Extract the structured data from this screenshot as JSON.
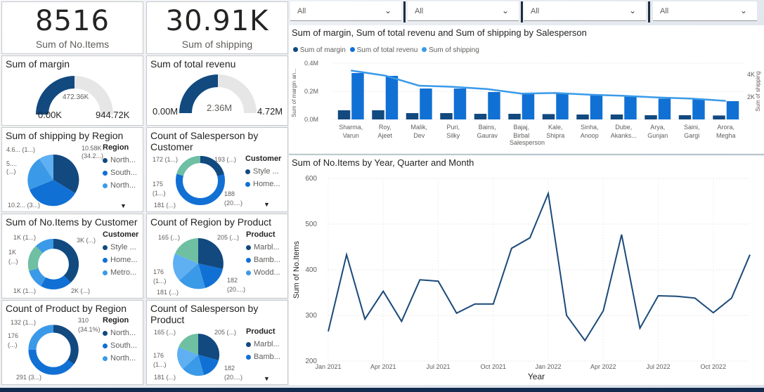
{
  "kpis": [
    {
      "value": "8516",
      "label": "Sum of No.Items"
    },
    {
      "value": "30.91K",
      "label": "Sum of shipping"
    }
  ],
  "gauges": [
    {
      "title": "Sum of margin",
      "min": "0.00K",
      "max": "944.72K",
      "center": "472.36K",
      "fill": 0.5
    },
    {
      "title": "Sum of total revenu",
      "min": "0.00M",
      "max": "4.72M",
      "center": "2.36M",
      "fill": 0.5
    }
  ],
  "slicers": [
    "All",
    "All",
    "All",
    "All"
  ],
  "pies": {
    "shipping_region": {
      "title": "Sum of shipping by Region",
      "legend_title": "Region",
      "legend": [
        "North...",
        "South...",
        "North..."
      ],
      "labels": [
        "10.58K",
        "(34.2...)",
        "4.6... (1...)",
        "5....",
        "(...)",
        "10.2... (3...)"
      ]
    },
    "salesperson_customer": {
      "title": "Count of Salesperson by Customer",
      "legend_title": "Customer",
      "legend": [
        "Style ...",
        "Home..."
      ],
      "labels": [
        "193 (...)",
        "172 (1...)",
        "175",
        "(1...)",
        "188",
        "(20....)",
        "181 (...)"
      ]
    },
    "items_customer": {
      "title": "Sum of No.Items by Customer",
      "legend_title": "Customer",
      "legend": [
        "Style ...",
        "Home...",
        "Metro..."
      ],
      "labels": [
        "1K (1...)",
        "3K (...)",
        "1K",
        "(...)",
        "1K (1...)",
        "2K (...)"
      ]
    },
    "region_product": {
      "title": "Count of Region by Product",
      "legend_title": "Product",
      "legend": [
        "Marbl...",
        "Bamb...",
        "Wodd..."
      ],
      "labels": [
        "165 (...)",
        "205 (...)",
        "176",
        "(1...)",
        "182",
        "(20....)",
        "181 (...)"
      ]
    },
    "product_region": {
      "title": "Count of Product by Region",
      "legend_title": "Region",
      "legend": [
        "North...",
        "South...",
        "North..."
      ],
      "labels": [
        "132 (1...)",
        "310",
        "(34.1%)",
        "176",
        "(...)",
        "291 (3...)"
      ]
    },
    "salesperson_product": {
      "title": "Count of Salesperson by Product",
      "legend_title": "Product",
      "legend": [
        "Marbl...",
        "Bamb..."
      ],
      "labels": [
        "165 (...)",
        "205 (...)",
        "176",
        "(1...)",
        "182",
        "(20....)",
        "181 (...)"
      ]
    }
  },
  "colors": {
    "dark_navy": "#12497f",
    "mid_blue": "#1170d4",
    "light_blue": "#3b9ae8",
    "teal": "#6fbfa3",
    "sky": "#5fb0f2",
    "line": "#1a4a7a"
  },
  "chart_data": [
    {
      "type": "bar",
      "title": "Sum of margin, Sum of total revenu and Sum of shipping by Salesperson",
      "legend": [
        "Sum of margin",
        "Sum of total revenu",
        "Sum of shipping"
      ],
      "xlabel": "Salesperson",
      "ylabel": "Sum of margin an...",
      "y2label": "Sum of shipping",
      "categories": [
        "Sharma, Varun",
        "Roy, Ajeet",
        "Malik, Dev",
        "Puri, Silky",
        "Bains, Gaurav",
        "Bajaj, Birbal",
        "Kale, Shipra",
        "Sinha, Anoop",
        "Dube, Akanks...",
        "Arya, Gunjan",
        "Saini, Gargi",
        "Arora, Megha"
      ],
      "y_ticks": [
        "0.0M",
        "0.2M",
        "0.4M"
      ],
      "y2_ticks": [
        "2K",
        "4K"
      ],
      "ylim": [
        0,
        0.4
      ],
      "y2lim": [
        0,
        5000
      ],
      "series": [
        {
          "name": "Sum of margin",
          "values": [
            0.065,
            0.065,
            0.045,
            0.045,
            0.04,
            0.04,
            0.038,
            0.035,
            0.035,
            0.03,
            0.03,
            0.028
          ]
        },
        {
          "name": "Sum of total revenu",
          "values": [
            0.33,
            0.31,
            0.22,
            0.22,
            0.195,
            0.19,
            0.185,
            0.17,
            0.165,
            0.148,
            0.145,
            0.13
          ]
        },
        {
          "name": "Sum of shipping",
          "values": [
            4350,
            3900,
            3000,
            2900,
            2700,
            2300,
            2350,
            2200,
            2100,
            1950,
            1850,
            1650
          ]
        }
      ]
    },
    {
      "type": "line",
      "title": "Sum of No.Items by Year, Quarter and Month",
      "xlabel": "Year",
      "ylabel": "Sum of No.Items",
      "x_ticks": [
        "Jan 2021",
        "Apr 2021",
        "Jul 2021",
        "Oct 2021",
        "Jan 2022",
        "Apr 2022",
        "Jul 2022",
        "Oct 2022"
      ],
      "y_ticks": [
        "200",
        "300",
        "400",
        "500",
        "600"
      ],
      "ylim": [
        200,
        600
      ],
      "x": [
        "Jan 2021",
        "Feb 2021",
        "Mar 2021",
        "Apr 2021",
        "May 2021",
        "Jun 2021",
        "Jul 2021",
        "Aug 2021",
        "Sep 2021",
        "Oct 2021",
        "Nov 2021",
        "Dec 2021",
        "Jan 2022",
        "Feb 2022",
        "Mar 2022",
        "Apr 2022",
        "May 2022",
        "Jun 2022",
        "Jul 2022",
        "Aug 2022",
        "Sep 2022",
        "Oct 2022",
        "Nov 2022",
        "Dec 2022"
      ],
      "values": [
        265,
        433,
        292,
        353,
        287,
        378,
        375,
        305,
        325,
        325,
        447,
        470,
        567,
        300,
        245,
        310,
        477,
        272,
        343,
        342,
        338,
        306,
        338,
        433
      ]
    }
  ]
}
